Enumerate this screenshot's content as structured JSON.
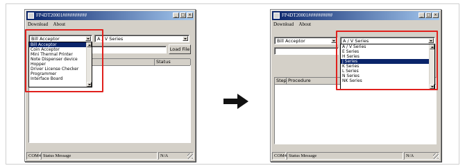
{
  "left_window": {
    "title": "FP4DT20001##########",
    "menu": [
      "Download",
      "About"
    ],
    "acceptor_combo": "Bill Acceptor",
    "series_combo": "A / V Series",
    "load_button": "Load File",
    "list_columns": {
      "status": "Status"
    },
    "dropdown_items": [
      "Bill Acceptor",
      "Coin Acceptor",
      "Mini Thermal Printer",
      "Note Dispenser device",
      "Hopper",
      "Driver License Checker",
      "Programmer",
      "Interface Board"
    ],
    "dropdown_selected_index": 0,
    "status_bar": {
      "port": "COM4",
      "message": "Status Message",
      "right": "N/A"
    }
  },
  "right_window": {
    "title": "FP4DT20001##########",
    "menu": [
      "Download",
      "About"
    ],
    "acceptor_combo": "Bill Acceptor",
    "series_combo": "A / V Series",
    "list_columns": {
      "step": "Step",
      "procedure": "Procedure"
    },
    "dropdown_items": [
      "A / V Series",
      "E Series",
      "H Series",
      "J Series",
      "K Series",
      "L Series",
      "N Series",
      "NK Series"
    ],
    "dropdown_selected_index": 3,
    "status_bar": {
      "port": "COM4",
      "message": "Status Message",
      "right": "N/A"
    }
  },
  "titlebar_buttons": [
    "_",
    "□",
    "×"
  ],
  "colors": {
    "highlight_box": "#e0201c",
    "arrow": "#111111",
    "title_gradient_start": "#0a246a",
    "selection": "#0a246a"
  },
  "icons": [
    "app-icon",
    "minimize-icon",
    "maximize-icon",
    "close-icon",
    "dropdown-arrow-icon",
    "right-arrow-icon",
    "size-grip-icon"
  ]
}
